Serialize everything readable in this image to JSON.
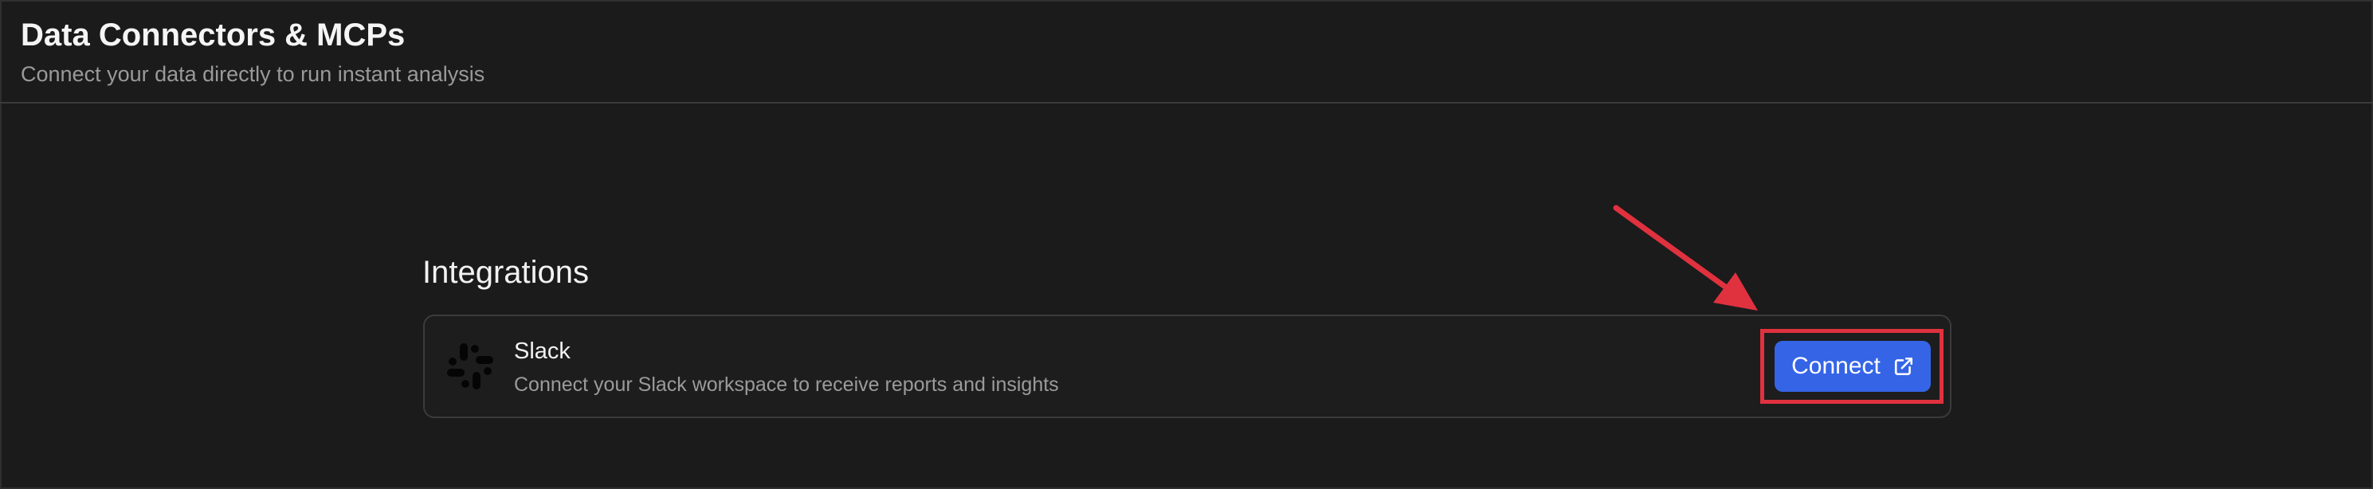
{
  "header": {
    "title": "Data Connectors & MCPs",
    "subtitle": "Connect your data directly to run instant analysis"
  },
  "integrations": {
    "section_title": "Integrations",
    "items": [
      {
        "name": "Slack",
        "description": "Connect your Slack workspace to receive reports and insights",
        "icon": "slack-logo-icon",
        "button_label": "Connect",
        "button_icon": "external-link-icon"
      }
    ]
  },
  "annotation": {
    "highlight_color": "#e0313f",
    "arrow_color": "#e0313f"
  },
  "colors": {
    "background": "#1b1b1b",
    "accent": "#3565e6"
  }
}
